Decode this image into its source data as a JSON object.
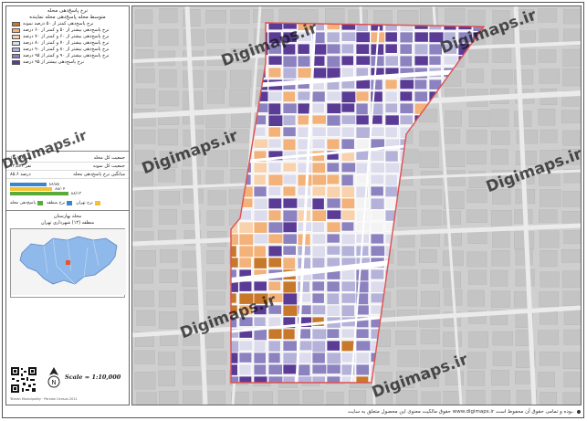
{
  "legend": {
    "title_line1": "نرخ پاسخ‌دهی محله",
    "title_line2": "متوسط محله پاسخ‌دهی محله نماینده",
    "items": [
      {
        "label": "نرخ پاسخ‌دهی کمتر از ۵۰ درصد نمونه",
        "color": "#c8782a"
      },
      {
        "label": "نرخ پاسخ‌دهی بیشتر از ۵۰ و کمتر از ۶۰ درصد",
        "color": "#f2b27a"
      },
      {
        "label": "نرخ پاسخ‌دهی بیشتر از ۶۰ و کمتر از ۷۰ درصد",
        "color": "#f7d2ad"
      },
      {
        "label": "نرخ پاسخ‌دهی بیشتر از ۷۰ و کمتر از ۸۰ درصد",
        "color": "#dcdcec"
      },
      {
        "label": "نرخ پاسخ‌دهی بیشتر از ۸۰ و کمتر از ۹۰ درصد",
        "color": "#b4b2d8"
      },
      {
        "label": "نرخ پاسخ‌دهی بیشتر از ۹۰ و کمتر از ۹۵ درصد",
        "color": "#8c82c0"
      },
      {
        "label": "نرخ پاسخ‌دهی بیشتر از ۹۵ درصد",
        "color": "#5a3c96"
      }
    ]
  },
  "stats": [
    {
      "label": "جمعیت کل محله",
      "value": "۱۵,۱۶۸ نفر"
    },
    {
      "label": "جمعیت کل نمونه",
      "value": "۱۲,۵۷۱ نفر"
    },
    {
      "label": "میانگین نرخ پاسخ‌دهی محله",
      "value": "۸۵.۶ درصد"
    }
  ],
  "bars": [
    {
      "label": "۸۶/۸۵",
      "color": "#3a86c8",
      "fraction": 0.36
    },
    {
      "label": "۸۸/۰۲",
      "color": "#f2c230",
      "fraction": 0.42
    },
    {
      "label": "۸۸/۱۳",
      "color": "#5aaa3c",
      "fraction": 0.58
    }
  ],
  "bar_keys": [
    {
      "label": "پاسخ‌دهی محله",
      "color": "#5aaa3c"
    },
    {
      "label": "نرخ منطقه",
      "color": "#3a86c8"
    },
    {
      "label": "نرخ تهران",
      "color": "#f2c230"
    }
  ],
  "location": {
    "line1": "محله بهارستان",
    "line2": "منطقه (۱۲) شهرداری تهران"
  },
  "scale_text": "Scale = 1:10,000",
  "credits_small": "Tehran Municipality · Persian Census 2011",
  "watermark": "Digimaps.ir",
  "footer": "حقوق مالکیت معنوی این محصول متعلق به سایت www.digimaps.ir بوده و تمامی حقوق آن محفوظ است.",
  "colors": {
    "boundary": "#e05050",
    "road": "#ebebeb",
    "block": "#c4c4c4"
  }
}
